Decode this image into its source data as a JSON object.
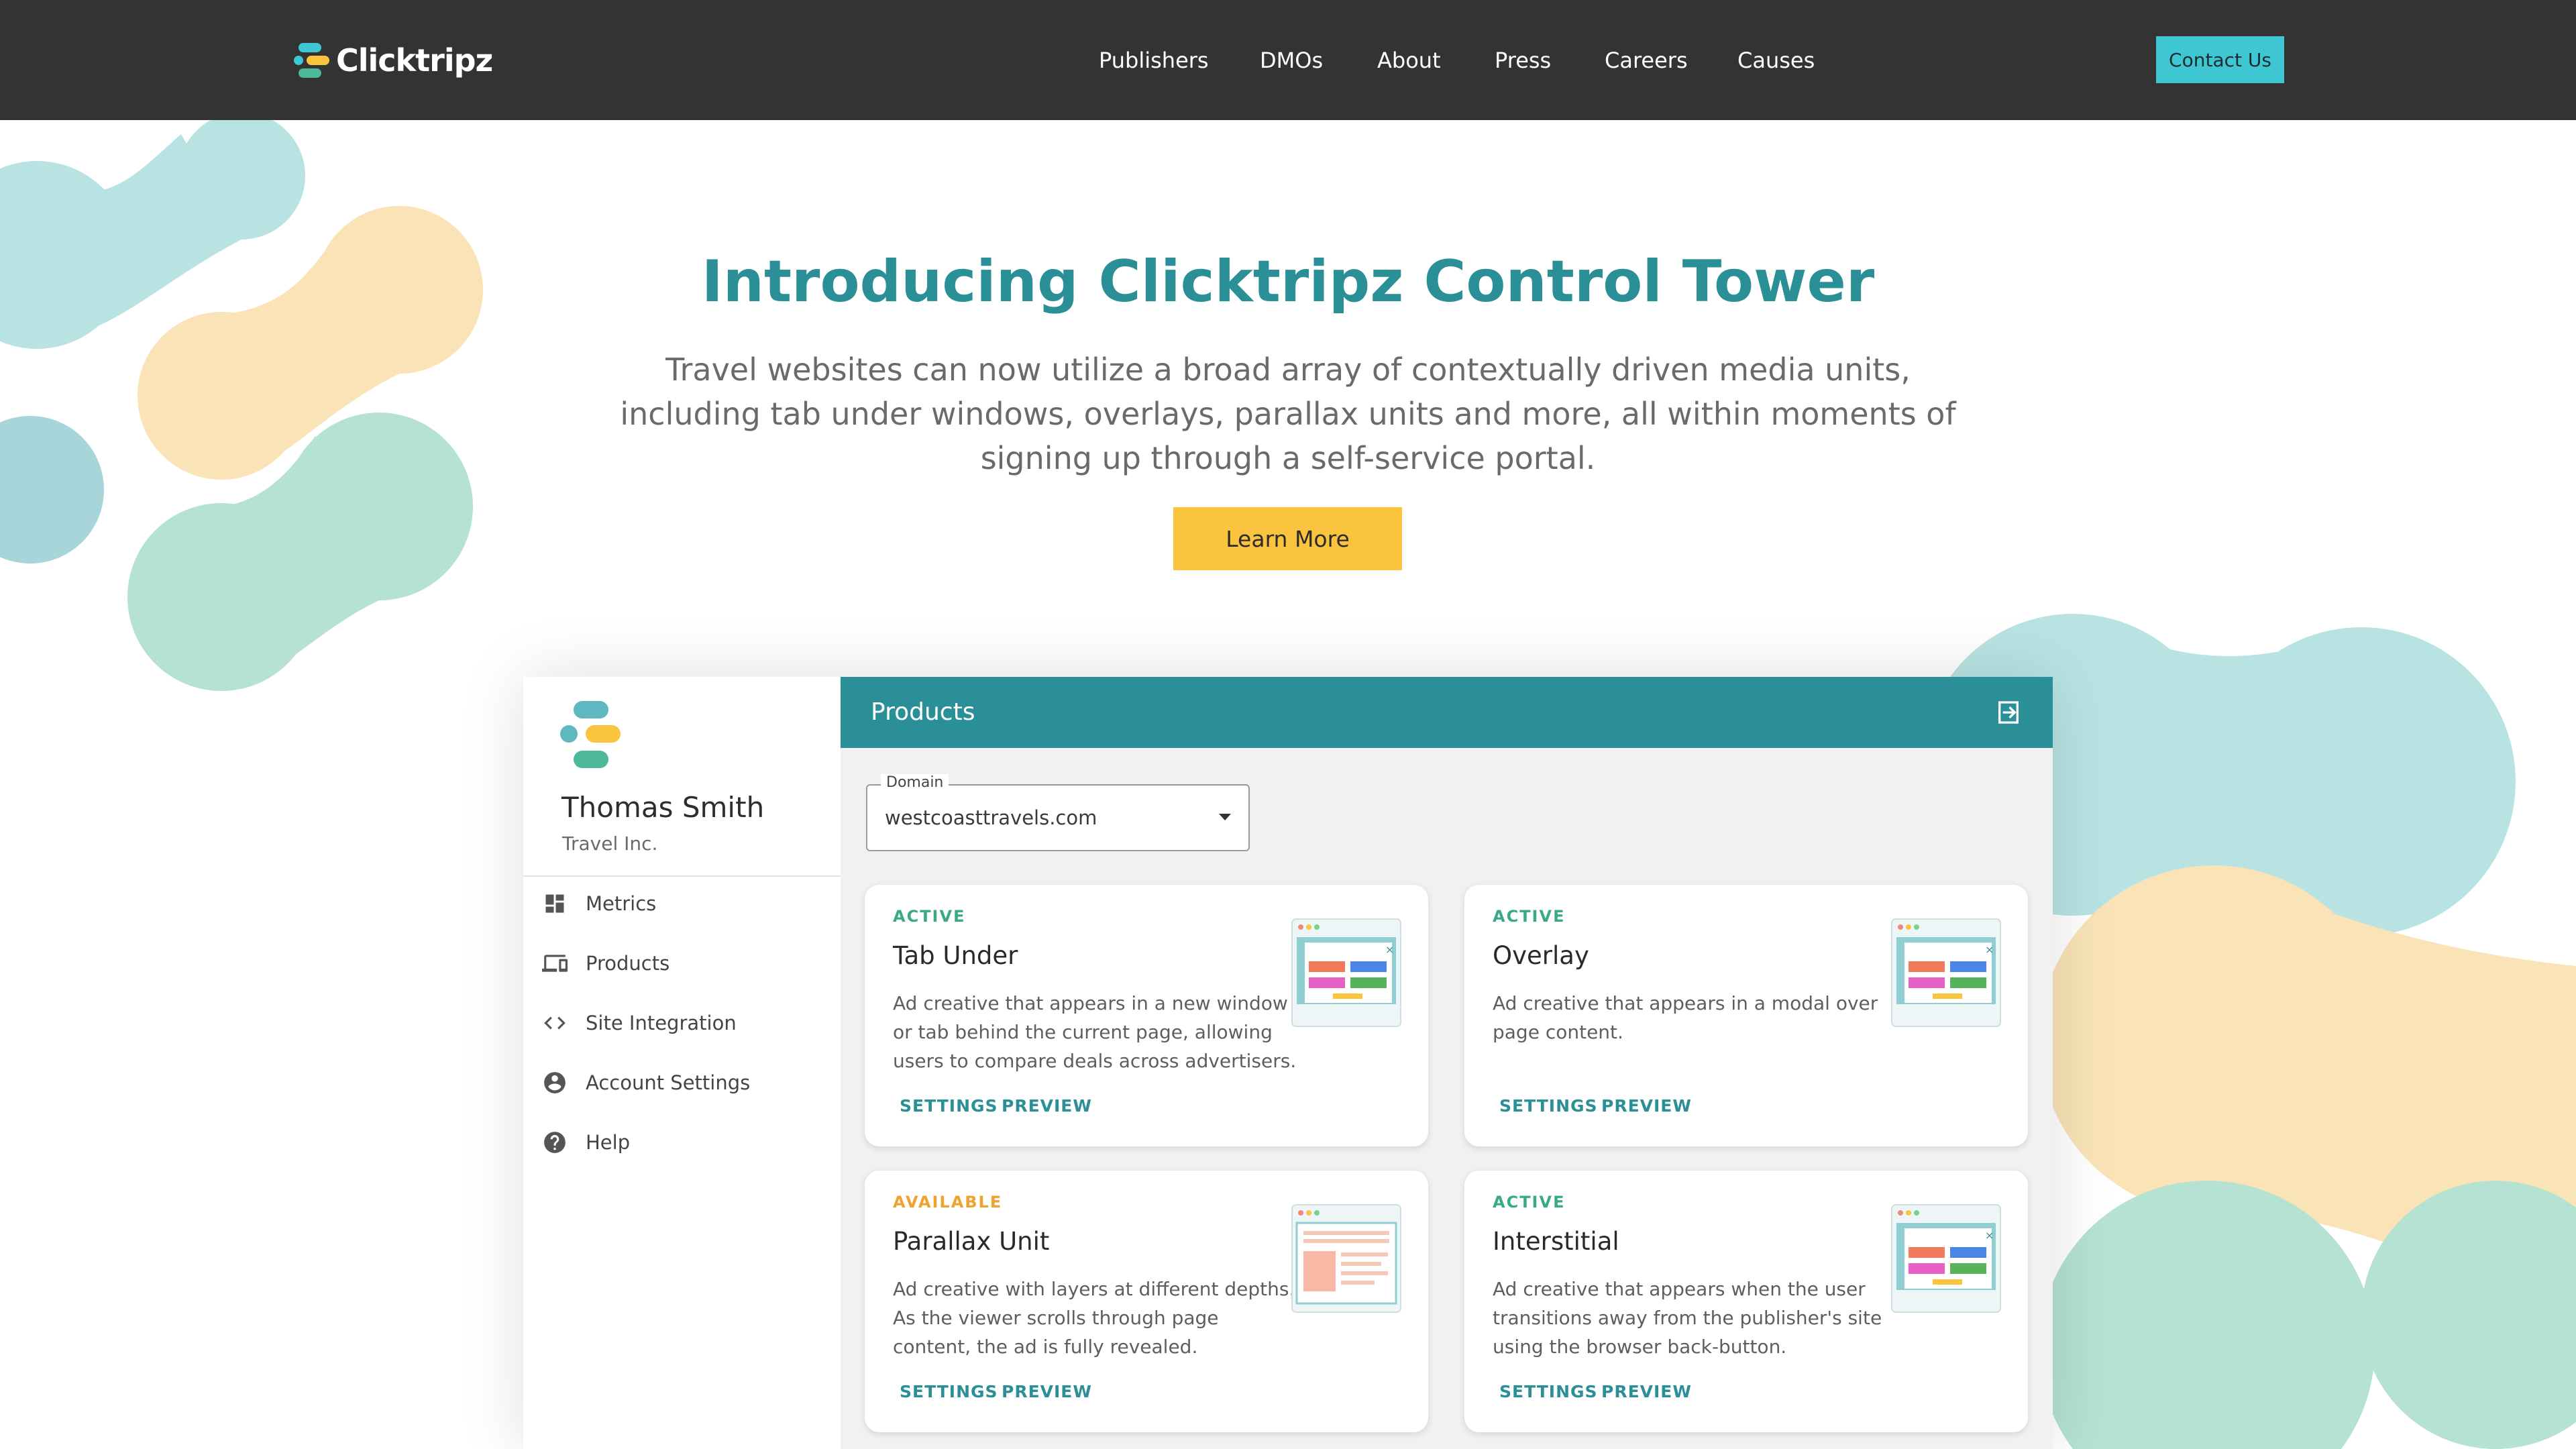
{
  "nav": {
    "logo_text": "Clicktripz",
    "items": [
      "Publishers",
      "DMOs",
      "About",
      "Press",
      "Careers",
      "Causes"
    ],
    "contact_label": "Contact Us"
  },
  "hero": {
    "title": "Introducing Clicktripz Control Tower",
    "subtitle": "Travel websites can now utilize a broad array of contextually driven media units, including tab under windows, overlays, parallax units and more, all within moments of signing up through a self-service portal.",
    "cta_label": "Learn More"
  },
  "dashboard": {
    "user": {
      "name": "Thomas Smith",
      "org": "Travel Inc."
    },
    "menu": [
      {
        "label": "Metrics",
        "icon": "dashboard-icon"
      },
      {
        "label": "Products",
        "icon": "devices-icon"
      },
      {
        "label": "Site Integration",
        "icon": "code-icon"
      },
      {
        "label": "Account Settings",
        "icon": "account-circle-icon"
      },
      {
        "label": "Help",
        "icon": "help-icon"
      }
    ],
    "header_title": "Products",
    "domain": {
      "label": "Domain",
      "value": "westcoasttravels.com"
    },
    "cards": [
      {
        "status": "ACTIVE",
        "title": "Tab Under",
        "description": "Ad creative that appears in a new window or tab behind the current page, allowing users to compare deals across advertisers.",
        "settings_label": "SETTINGS",
        "preview_label": "PREVIEW"
      },
      {
        "status": "ACTIVE",
        "title": "Overlay",
        "description": "Ad creative that appears in a modal over page content.",
        "settings_label": "SETTINGS",
        "preview_label": "PREVIEW"
      },
      {
        "status": "AVAILABLE",
        "title": "Parallax Unit",
        "description": "Ad creative with layers at different depths. As the viewer scrolls through page content, the ad is fully revealed.",
        "settings_label": "SETTINGS",
        "preview_label": "PREVIEW"
      },
      {
        "status": "ACTIVE",
        "title": "Interstitial",
        "description": "Ad creative that appears when the user transitions away from the publisher's site using the browser back-button.",
        "settings_label": "SETTINGS",
        "preview_label": "PREVIEW"
      }
    ]
  },
  "colors": {
    "brand_teal": "#2a8f97",
    "nav_bg": "#333333",
    "contact_bg": "#3ec7d3",
    "cta_yellow": "#fbc43e",
    "status_active": "#3aa98a",
    "status_available": "#f0a22e"
  }
}
